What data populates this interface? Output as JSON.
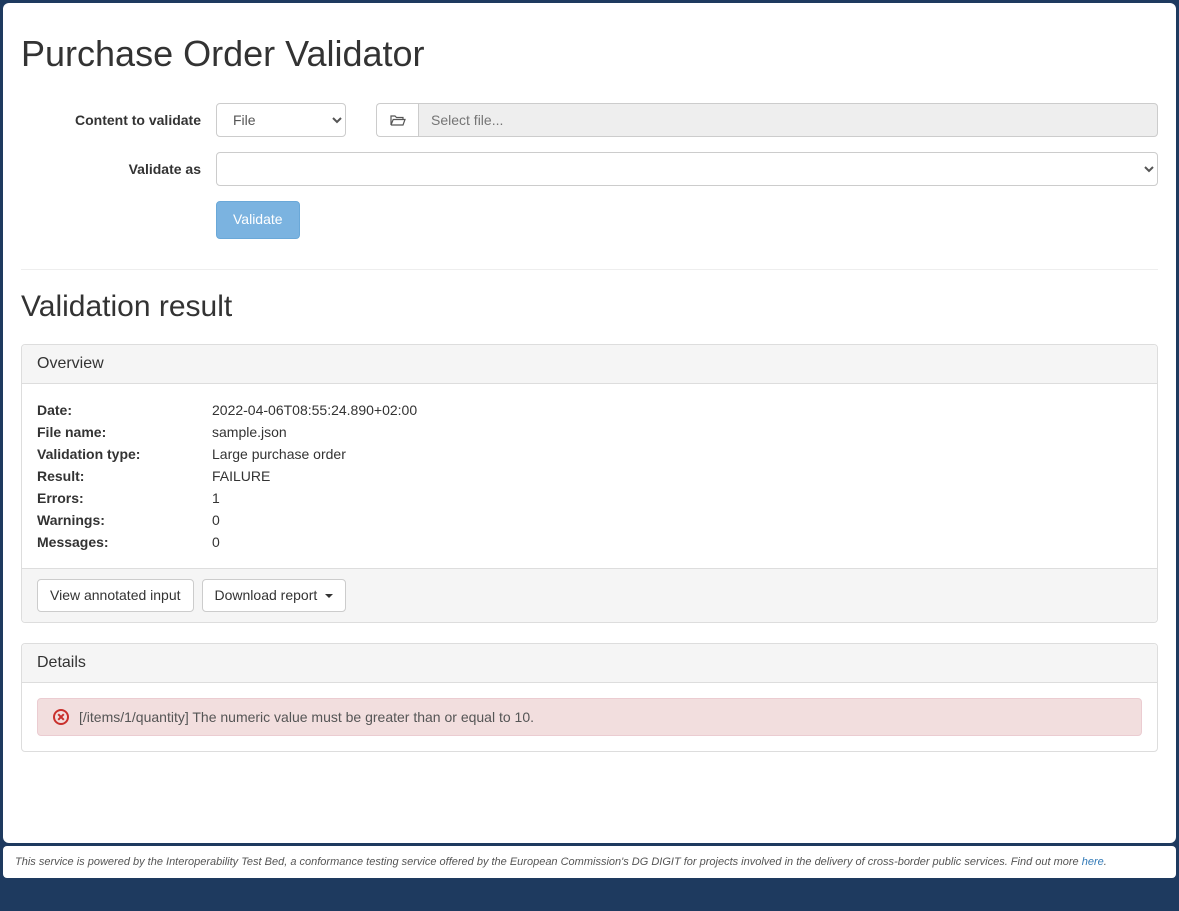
{
  "header": {
    "title": "Purchase Order Validator"
  },
  "form": {
    "contentLabel": "Content to validate",
    "contentSelect": "File",
    "filePlaceholder": "Select file...",
    "validateAsLabel": "Validate as",
    "validateButton": "Validate"
  },
  "result": {
    "title": "Validation result",
    "overviewHeading": "Overview",
    "fields": {
      "dateLabel": "Date:",
      "dateValue": "2022-04-06T08:55:24.890+02:00",
      "fileNameLabel": "File name:",
      "fileNameValue": "sample.json",
      "validationTypeLabel": "Validation type:",
      "validationTypeValue": "Large purchase order",
      "resultLabel": "Result:",
      "resultValue": "FAILURE",
      "errorsLabel": "Errors:",
      "errorsValue": "1",
      "warningsLabel": "Warnings:",
      "warningsValue": "0",
      "messagesLabel": "Messages:",
      "messagesValue": "0"
    },
    "actions": {
      "viewAnnotated": "View annotated input",
      "downloadReport": "Download report"
    },
    "detailsHeading": "Details",
    "errorMessage": "[/items/1/quantity] The numeric value must be greater than or equal to 10."
  },
  "footer": {
    "text": "This service is powered by the Interoperability Test Bed, a conformance testing service offered by the European Commission's DG DIGIT for projects involved in the delivery of cross-border public services. Find out more ",
    "linkText": "here",
    "suffix": "."
  }
}
